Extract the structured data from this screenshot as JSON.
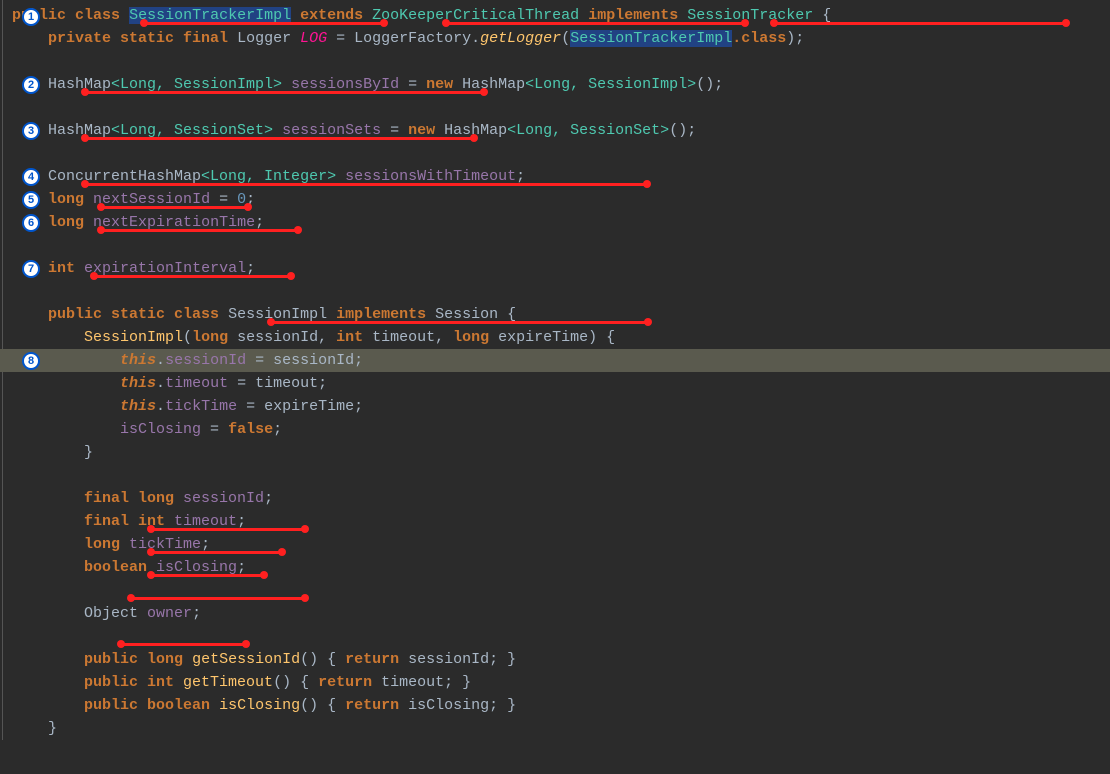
{
  "badges": [
    "1",
    "2",
    "3",
    "4",
    "5",
    "6",
    "7",
    "8"
  ],
  "code": {
    "l1_pub": "public",
    "l1_class": "class",
    "l1_name": "SessionTrackerImpl",
    "l1_ext": "extends",
    "l1_sup": "ZooKeeperCriticalThread",
    "l1_impl": "implements",
    "l1_if": "SessionTracker",
    "l1_ob": " {",
    "l2_mods": "private static final",
    "l2_type": "Logger",
    "l2_var": "LOG",
    "l2_eq": " = ",
    "l2_fact": "LoggerFactory",
    "l2_dot": ".",
    "l2_get": "getLogger",
    "l2_op": "(",
    "l2_arg": "SessionTrackerImpl",
    "l2_cls": ".class",
    "l2_cl": ");",
    "l4_t": "HashMap",
    "l4_g": "<Long, SessionImpl>",
    "l4_v": "sessionsById",
    "l4_eq": " = ",
    "l4_n": "new",
    "l4_t2": " HashMap",
    "l4_g2": "<Long, SessionImpl>",
    "l4_cl": "();",
    "l6_t": "HashMap",
    "l6_g": "<Long, SessionSet>",
    "l6_v": "sessionSets",
    "l6_eq": " = ",
    "l6_n": "new",
    "l6_t2": " HashMap",
    "l6_g2": "<Long, SessionSet>",
    "l6_cl": "();",
    "l8_t": "ConcurrentHashMap",
    "l8_g": "<Long, Integer>",
    "l8_v": "sessionsWithTimeout",
    "l8_sc": ";",
    "l9_t": "long",
    "l9_v": "nextSessionId",
    "l9_eq": " = ",
    "l9_n": "0",
    "l9_sc": ";",
    "l10_t": "long",
    "l10_v": "nextExpirationTime",
    "l10_sc": ";",
    "l12_t": "int",
    "l12_v": "expirationInterval",
    "l12_sc": ";",
    "l14_mods": "public static class",
    "l14_n": "SessionImpl",
    "l14_impl": "implements",
    "l14_if": "Session",
    "l14_ob": " {",
    "l15_ctor": "SessionImpl",
    "l15_op": "(",
    "l15_t1": "long",
    "l15_p1": " sessionId, ",
    "l15_t2": "int",
    "l15_p2": " timeout, ",
    "l15_t3": "long",
    "l15_p3": " expireTime) {",
    "l16_this": "this",
    "l16_d": ".",
    "l16_f": "sessionId",
    "l16_eq": " = ",
    "l16_r": "sessionId;",
    "l17_this": "this",
    "l17_d": ".",
    "l17_f": "timeout",
    "l17_eq": " = ",
    "l17_r": "timeout;",
    "l18_this": "this",
    "l18_d": ".",
    "l18_f": "tickTime",
    "l18_eq": " = ",
    "l18_r": "expireTime;",
    "l19_f": "isClosing",
    "l19_eq": " = ",
    "l19_v": "false",
    "l19_sc": ";",
    "l20_cb": "}",
    "l22_m": "final long",
    "l22_v": "sessionId",
    "l22_sc": ";",
    "l23_m": "final int",
    "l23_v": "timeout",
    "l23_sc": ";",
    "l24_m": "long",
    "l24_v": "tickTime",
    "l24_sc": ";",
    "l25_m": "boolean",
    "l25_v": "isClosing",
    "l25_sc": ";",
    "l27_t": "Object",
    "l27_v": "owner",
    "l27_sc": ";",
    "l29_m": "public long",
    "l29_fn": "getSessionId",
    "l29_op": "() { ",
    "l29_r": "return",
    "l29_v": " sessionId; }",
    "l30_m": "public int",
    "l30_fn": "getTimeout",
    "l30_op": "() { ",
    "l30_r": "return",
    "l30_v": " timeout; }",
    "l31_m": "public boolean",
    "l31_fn": "isClosing",
    "l31_op": "() { ",
    "l31_r": "return",
    "l31_v": " isClosing; }",
    "l32_cb": "}"
  }
}
